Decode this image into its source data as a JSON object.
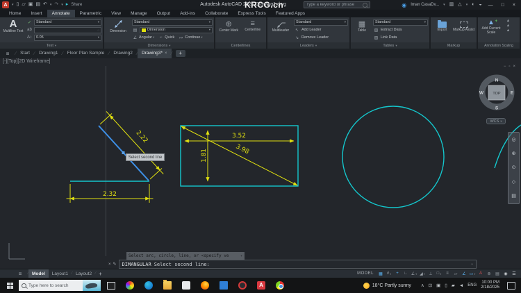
{
  "watermark": "KRCG.cn",
  "colors": {
    "geometry_cyan": "#14c6cc",
    "dimension_yellow": "#e0e010",
    "selected_blue": "#3d8fe6",
    "status_active_blue": "#5ab2f0",
    "app_logo_red": "#c0392b"
  },
  "titlebar": {
    "app_title": "Autodesk AutoCAD 2025   Drawing1.dwg",
    "search_placeholder": "Type a keyword or phrase",
    "username": "Iman CasaDv...",
    "share_label": "Share"
  },
  "ribbon": {
    "active_tab": "Annotate",
    "tabs": [
      "Home",
      "Insert",
      "Annotate",
      "Parametric",
      "View",
      "Manage",
      "Output",
      "Add-ins",
      "Collaborate",
      "Express Tools",
      "Featured Apps"
    ]
  },
  "panels": {
    "text": {
      "label": "Text",
      "big": "Multiline Text",
      "style": "Standard",
      "height": "0.05"
    },
    "dimensions": {
      "label": "Dimensions",
      "big": "Dimension",
      "style": "Standard",
      "layer": "Dimension",
      "b1": "Angular",
      "b2": "Quick",
      "b3": "Continue"
    },
    "centerlines": {
      "label": "Centerlines",
      "i1": "Center Mark",
      "i2": "Centerline"
    },
    "leaders": {
      "label": "Leaders",
      "big": "Multileader",
      "style": "Standard",
      "b1": "Add Leader",
      "b2": "Remove Leader"
    },
    "tables": {
      "label": "Tables",
      "big": "Table",
      "style": "Standard",
      "b1": "Extract Data",
      "b2": "Link Data"
    },
    "markup": {
      "label": "Markup",
      "i1": "Import",
      "i2": "Markup Assist"
    },
    "annotation_scaling": {
      "label": "Annotation Scaling",
      "big": "Add Current Scale"
    }
  },
  "doc_tabs": [
    "Start",
    "Drawing1",
    "Floor Plan Sample",
    "Drawing2",
    "Drawing3*"
  ],
  "canvas": {
    "viewport_label": "[-][Top][2D Wireframe]",
    "tooltip": "Select second line",
    "viewcube": {
      "n": "N",
      "e": "E",
      "s": "S",
      "w": "W",
      "face": "TOP",
      "ucs": "WCS"
    },
    "dims": {
      "aligned": "2.22",
      "bottom": "2.32",
      "width": "3.52",
      "height": "1.81",
      "diagonal": "3.98"
    }
  },
  "command": {
    "history": "Select arc, circle, line, or <specify ve",
    "name": "DIMANGULAR",
    "prompt": "Select second line:"
  },
  "statusbar": {
    "tabs": [
      "Model",
      "Layout1",
      "Layout2"
    ],
    "mode": "MODEL"
  },
  "taskbar": {
    "search_placeholder": "Type here to search",
    "weather": "18°C  Partly sunny",
    "lang": "ENG",
    "time": "10:00 PM",
    "date": "2/18/2025"
  }
}
